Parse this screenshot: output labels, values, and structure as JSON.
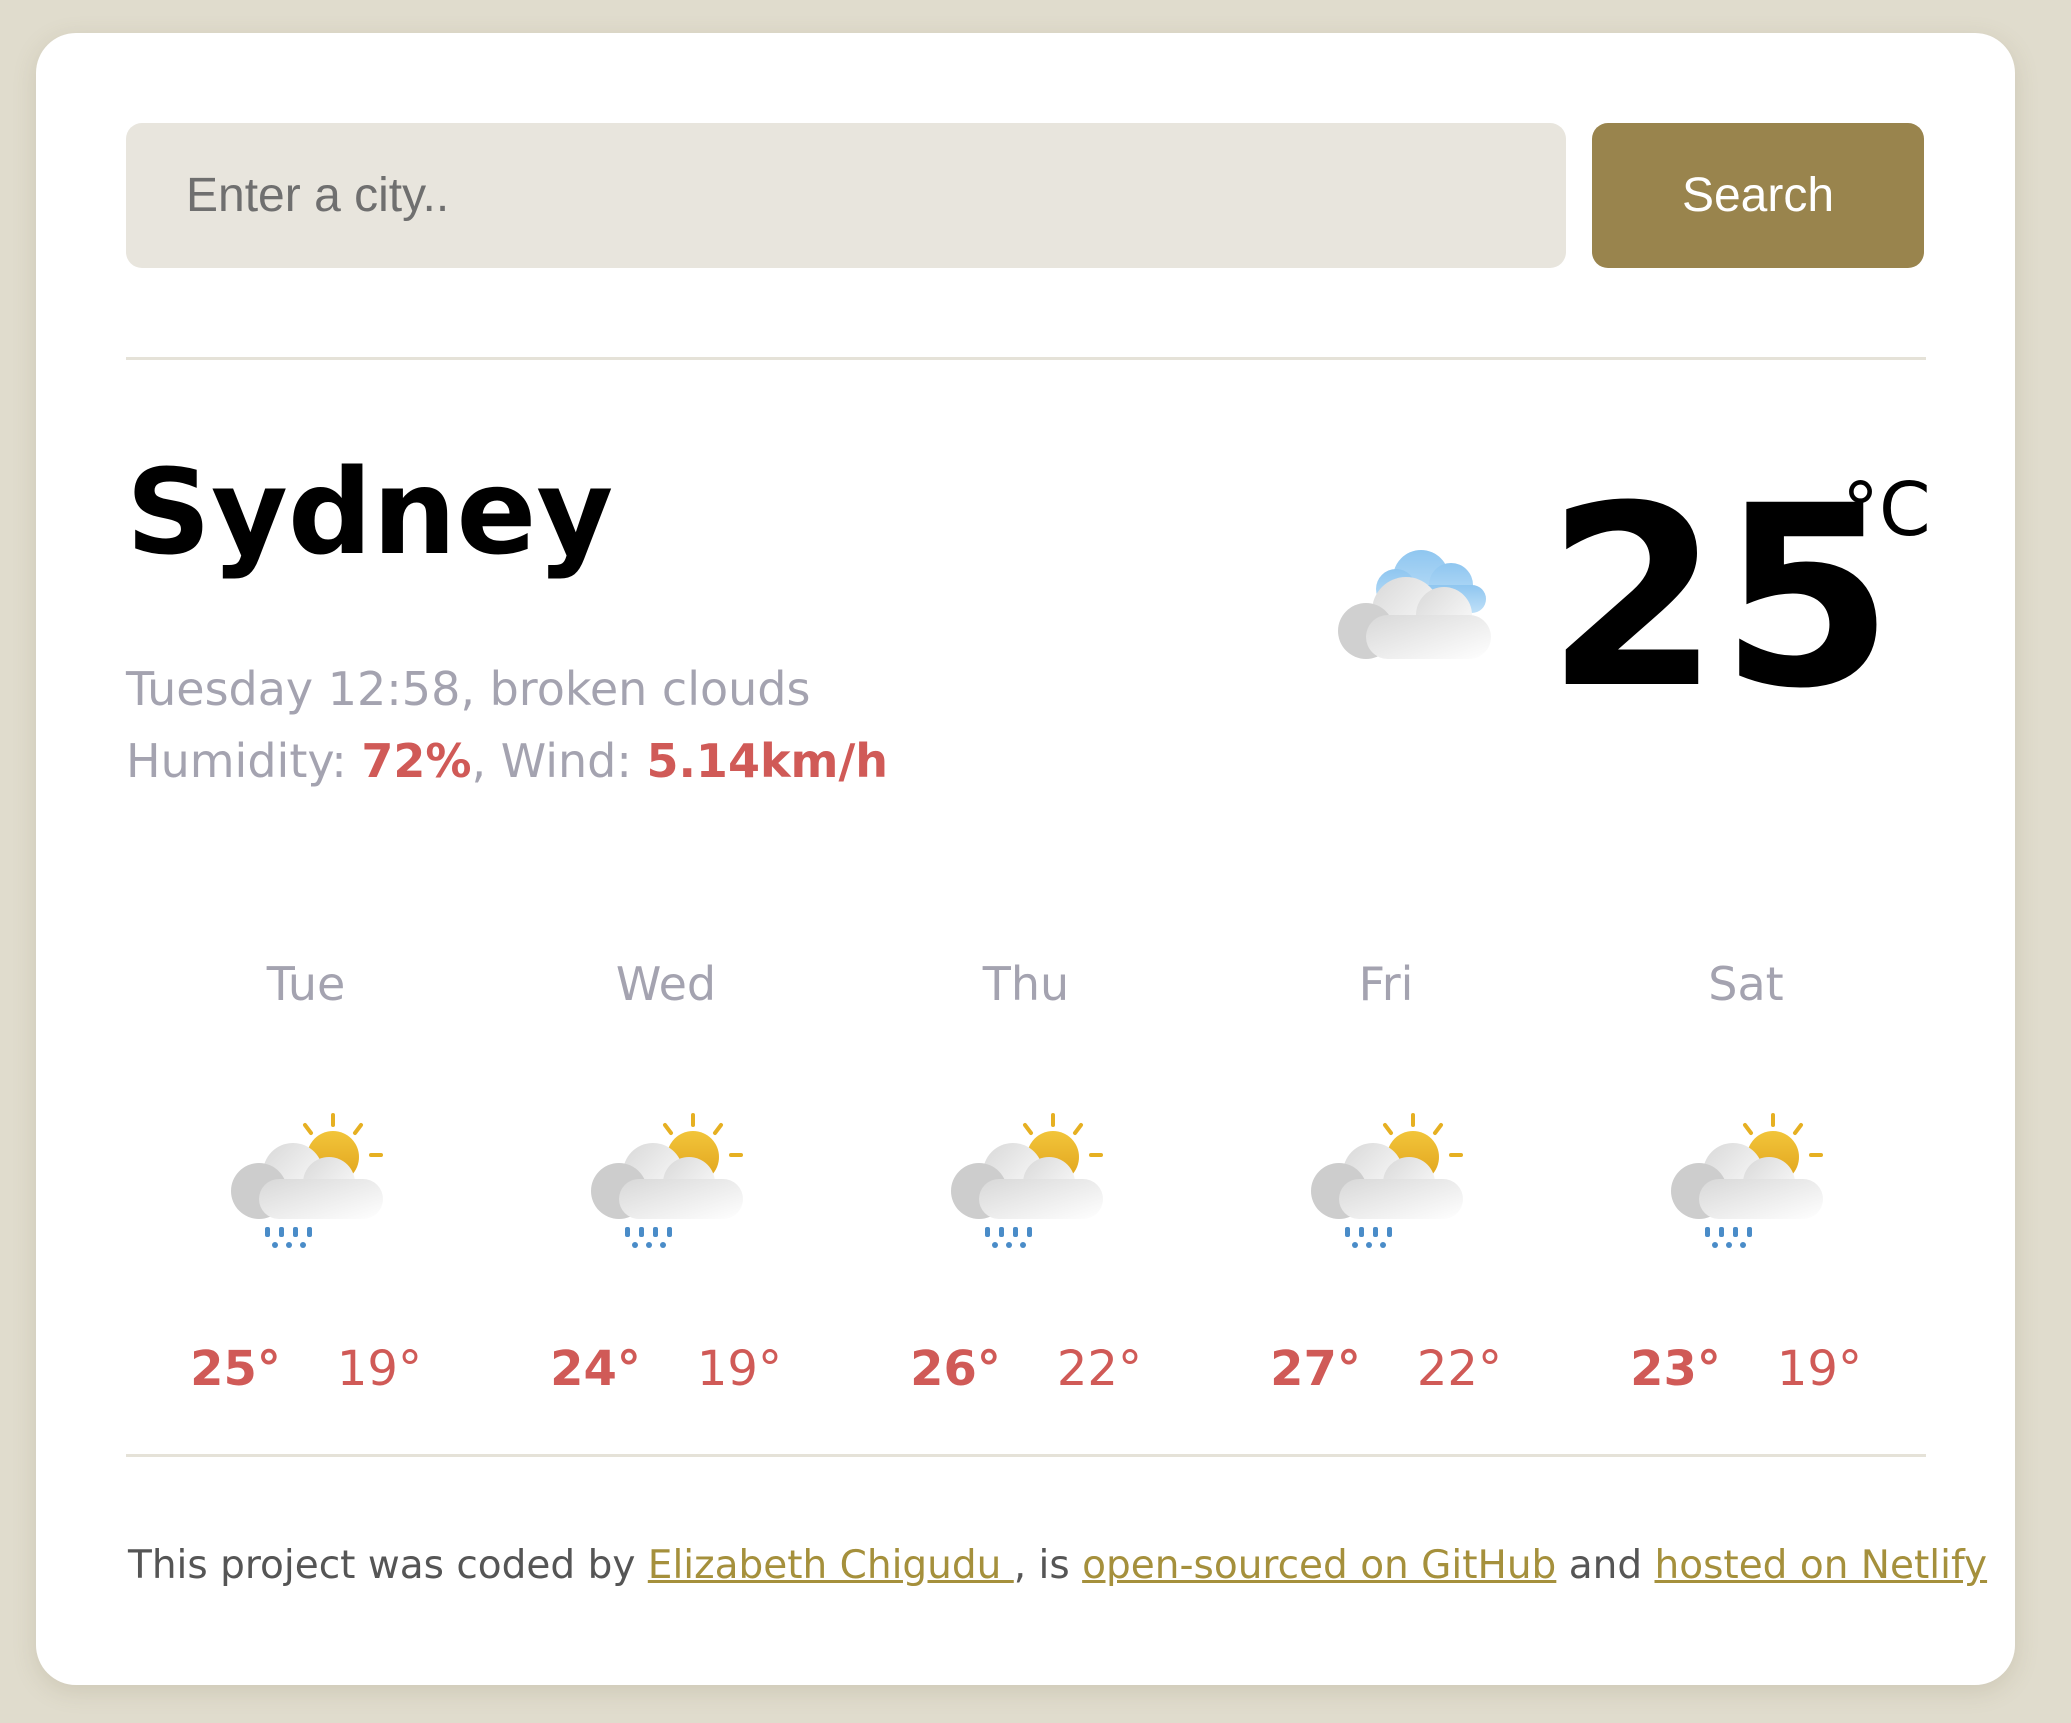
{
  "search": {
    "placeholder": "Enter a city..",
    "button_label": "Search"
  },
  "current": {
    "city": "Sydney",
    "day_time": "Tuesday 12:58",
    "description": "broken clouds",
    "humidity_label": "Humidity:",
    "humidity": "72%",
    "wind_label": "Wind:",
    "wind": "5.14km/h",
    "temperature": "25",
    "unit": "°C",
    "icon": "broken-clouds-icon"
  },
  "forecast": [
    {
      "day": "Tue",
      "max": "25°",
      "min": "19°",
      "icon": "sun-cloud-rain-icon"
    },
    {
      "day": "Wed",
      "max": "24°",
      "min": "19°",
      "icon": "sun-cloud-rain-icon"
    },
    {
      "day": "Thu",
      "max": "26°",
      "min": "22°",
      "icon": "sun-cloud-rain-icon"
    },
    {
      "day": "Fri",
      "max": "27°",
      "min": "22°",
      "icon": "sun-cloud-rain-icon"
    },
    {
      "day": "Sat",
      "max": "23°",
      "min": "19°",
      "icon": "sun-cloud-rain-icon"
    }
  ],
  "footer": {
    "text1": "This project was coded by ",
    "author": "Elizabeth Chigudu ",
    "text2": ", is ",
    "github": "open-sourced on GitHub",
    "text3": " and ",
    "netlify": "hosted on Netlify"
  },
  "colors": {
    "accent": "#99844d",
    "highlight": "#d05a57",
    "muted": "#a4a3b0",
    "link": "#a5903c",
    "background": "#e0dccd"
  }
}
